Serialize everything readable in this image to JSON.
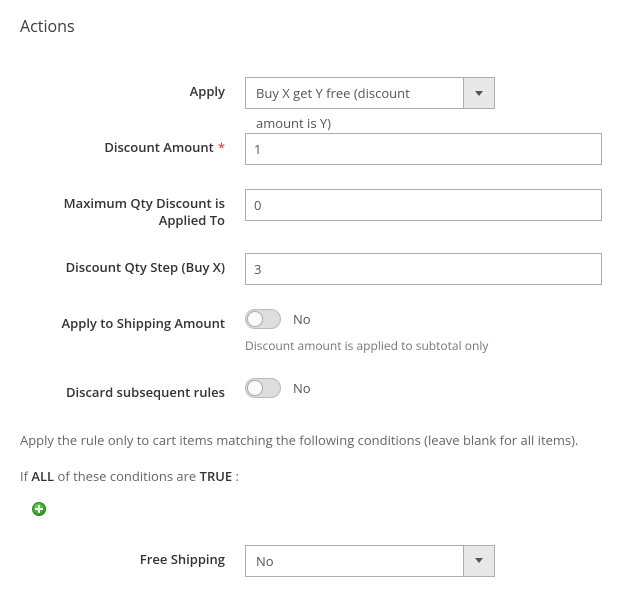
{
  "section_title": "Actions",
  "fields": {
    "apply": {
      "label": "Apply",
      "value": "Buy X get Y free (discount amount is Y)"
    },
    "discount_amount": {
      "label": "Discount Amount",
      "value": "1",
      "required": true
    },
    "max_qty": {
      "label": "Maximum Qty Discount is Applied To",
      "value": "0"
    },
    "qty_step": {
      "label": "Discount Qty Step (Buy X)",
      "value": "3"
    },
    "apply_shipping": {
      "label": "Apply to Shipping Amount",
      "value": "No",
      "hint": "Discount amount is applied to subtotal only"
    },
    "discard_rules": {
      "label": "Discard subsequent rules",
      "value": "No"
    },
    "free_shipping": {
      "label": "Free Shipping",
      "value": "No"
    }
  },
  "conditions": {
    "intro": "Apply the rule only to cart items matching the following conditions (leave blank for all items).",
    "prefix": "If ",
    "aggregator": "ALL",
    "mid": " of these conditions are ",
    "value": "TRUE",
    "suffix": " :"
  }
}
